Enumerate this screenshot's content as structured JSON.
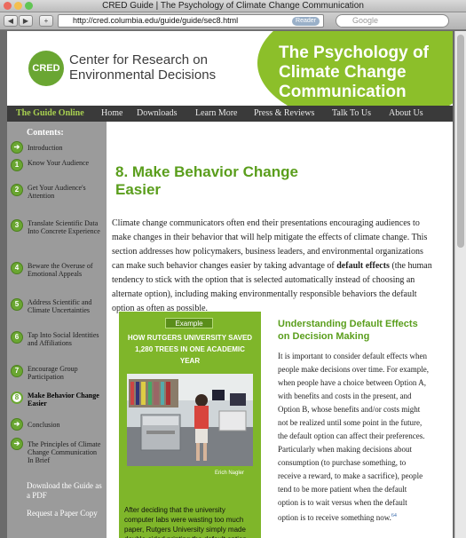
{
  "browser": {
    "window_title": "CRED Guide | The Psychology of Climate Change Communication",
    "url": "http://cred.columbia.edu/guide/guide/sec8.html",
    "reader_label": "Reader",
    "search_placeholder": "Google"
  },
  "header": {
    "logo_text": "CRED",
    "org_name": "Center for Research on Environmental Decisions",
    "site_title": "The Psychology of Climate Change Communication"
  },
  "nav": {
    "items": [
      "The Guide Online",
      "Home",
      "Downloads",
      "Learn More",
      "Press & Reviews",
      "Talk To Us",
      "About Us"
    ]
  },
  "sidebar": {
    "heading": "Contents:",
    "items": [
      {
        "badge": "➔",
        "label": "Introduction"
      },
      {
        "badge": "1",
        "label": "Know Your Audience"
      },
      {
        "badge": "2",
        "label": "Get Your Audience's Attention"
      },
      {
        "badge": "3",
        "label": "Translate Scientific Data Into Concrete Experience"
      },
      {
        "badge": "4",
        "label": "Beware the Overuse of Emotional Appeals"
      },
      {
        "badge": "5",
        "label": "Address Scientific and Climate Uncertainties"
      },
      {
        "badge": "6",
        "label": "Tap Into Social Identities and Affiliations"
      },
      {
        "badge": "7",
        "label": "Encourage Group Participation"
      },
      {
        "badge": "8",
        "label": "Make Behavior Change Easier"
      },
      {
        "badge": "➔",
        "label": "Conclusion"
      },
      {
        "badge": "➔",
        "label": "The Principles of Climate Change Communication In Brief"
      }
    ],
    "link_pdf": "Download the Guide as a PDF",
    "link_paper": "Request a Paper Copy"
  },
  "main": {
    "heading": "8. Make Behavior Change Easier",
    "intro_before": "Climate change communicators often end their presentations encouraging audiences to make changes in their behavior that will help mitigate the effects of climate change. This section addresses how policymakers, business leaders, and environmental organizations can make such behavior changes easier by taking advantage of ",
    "intro_bold": "default effects",
    "intro_after": " (the human tendency to stick with the option that is selected automatically instead of choosing an alternate option), including making environmentally responsible behaviors the default option as often as possible.",
    "example": {
      "tag": "Example",
      "headline": "HOW RUTGERS UNIVERSITY SAVED 1,280 TREES IN ONE ACADEMIC YEAR",
      "photo_credit": "Erich Nagler",
      "body": "After deciding that the university computer labs were wasting too much paper, Rutgers University simply made double-sided printing the default option on its lab printers. This tiny act saved"
    },
    "subheading": "Understanding Default Effects on Decision Making",
    "body": "It is important to consider default effects when people make decisions over time. For example, when people have a choice between Option A, with benefits and costs in the present, and Option B, whose benefits and/or costs might not be realized until some point in the future, the default option can affect their preferences. Particularly when making decisions about consumption (to purchase something, to receive a reward, to make a sacrifice), people tend to be more patient when the default option is to wait versus when the default option is to receive something now.",
    "footnote": "64"
  },
  "colors": {
    "brand_green": "#6aa632",
    "title_oval": "#8cbf2a",
    "nav_bg": "#3a3a3a",
    "sidebar_bg": "#9b9b9b"
  }
}
